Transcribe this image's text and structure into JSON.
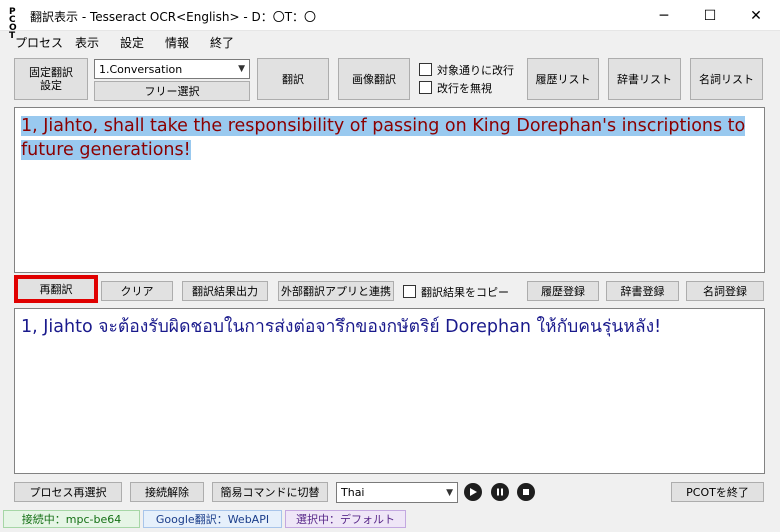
{
  "window": {
    "title": "翻訳表示 - Tesseract OCR<English> - D：〇T：〇",
    "icon_text": "PC OT"
  },
  "window_controls": {
    "minimize": "─",
    "maximize": "☐",
    "close": "✕"
  },
  "menu": [
    "プロセス",
    "表示",
    "設定",
    "情報",
    "終了"
  ],
  "toolbar": {
    "fixed_translation": "固定翻訳\n設定",
    "mode_select": "1.Conversation",
    "free_select": "フリー選択",
    "translate": "翻訳",
    "image_translate": "画像翻訳",
    "chk_newline_as_is": "対象通りに改行",
    "chk_ignore_newline": "改行を無視",
    "history_list": "履歴リスト",
    "dictionary_list": "辞書リスト",
    "noun_list": "名詞リスト"
  },
  "source_text": "1, Jiahto, shall take the responsibility of passing on King Dorephan's inscriptions to future generations!",
  "action_bar": {
    "retranslate": "再翻訳",
    "clear": "クリア",
    "output_result": "翻訳結果出力",
    "external_app": "外部翻訳アプリと連携",
    "copy_result": "翻訳結果をコピー",
    "history_register": "履歴登録",
    "dictionary_register": "辞書登録",
    "noun_register": "名詞登録"
  },
  "translated_text": "1, Jiahto จะต้องรับผิดชอบในการส่งต่อจารึกของกษัตริย์ Dorephan ให้กับคนรุ่นหลัง!",
  "bottom_bar": {
    "reselect_process": "プロセス再選択",
    "disconnect": "接続解除",
    "switch_simple_cmd": "簡易コマンドに切替",
    "language": "Thai",
    "exit": "PCOTを終了"
  },
  "status": {
    "connection": "接続中：mpc-be64",
    "engine": "Google翻訳：WebAPI",
    "selection": "選択中：デフォルト"
  },
  "colors": {
    "highlight": "#99c9ef",
    "source_text": "#8b0000",
    "translated_text": "#1a1a8c",
    "focus_border": "#e00000"
  }
}
